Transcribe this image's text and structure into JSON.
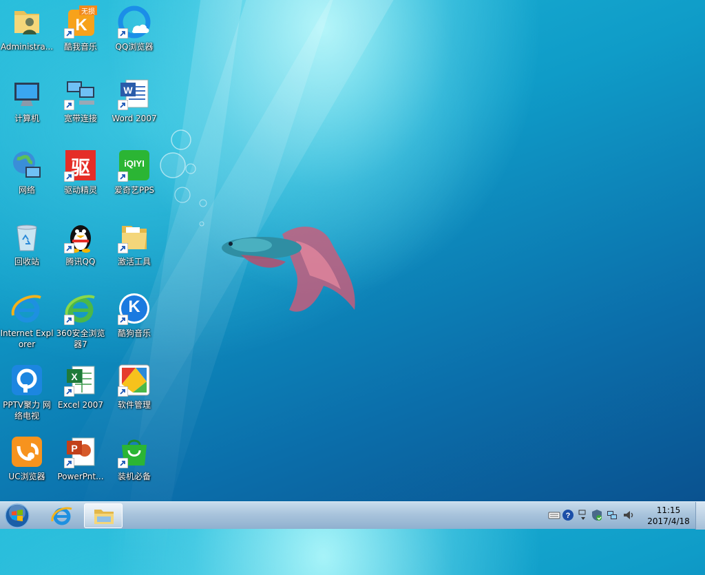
{
  "desktop": {
    "icons": [
      {
        "label": "Administra..."
      },
      {
        "label": "酷我音乐",
        "badge": "无损"
      },
      {
        "label": "QQ浏览器"
      },
      {
        "label": "计算机"
      },
      {
        "label": "宽带连接"
      },
      {
        "label": "Word 2007"
      },
      {
        "label": "网络"
      },
      {
        "label": "驱动精灵",
        "glyph": "驱"
      },
      {
        "label": "爱奇艺PPS",
        "glyph": "iQIYI"
      },
      {
        "label": "回收站"
      },
      {
        "label": "腾讯QQ"
      },
      {
        "label": "激活工具"
      },
      {
        "label": "Internet Explorer"
      },
      {
        "label": "360安全浏览器7"
      },
      {
        "label": "酷狗音乐",
        "glyph": "K"
      },
      {
        "label": "PPTV聚力 网络电视"
      },
      {
        "label": "Excel 2007"
      },
      {
        "label": "软件管理"
      },
      {
        "label": "UC浏览器"
      },
      {
        "label": "PowerPnt..."
      },
      {
        "label": "装机必备"
      }
    ]
  },
  "taskbar": {
    "clock_time": "11:15",
    "clock_date": "2017/4/18"
  },
  "colors": {
    "taskbar_top": "#c8dcec",
    "taskbar_bottom": "#8fb0cf",
    "desktop_accent": "#0f9cc8"
  }
}
